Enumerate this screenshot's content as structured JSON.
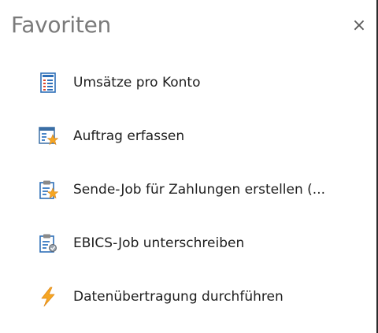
{
  "panel": {
    "title": "Favoriten",
    "close_glyph": "×"
  },
  "items": [
    {
      "label": "Umsätze pro Konto",
      "icon": "statement-list-icon"
    },
    {
      "label": "Auftrag erfassen",
      "icon": "new-order-icon"
    },
    {
      "label": "Sende-Job für Zahlungen erstellen (...",
      "icon": "clipboard-star-icon"
    },
    {
      "label": "EBICS-Job unterschreiben",
      "icon": "clipboard-sign-icon"
    },
    {
      "label": "Datenübertragung durchführen",
      "icon": "lightning-icon"
    }
  ],
  "colors": {
    "title": "#7a7a7a",
    "text": "#1e1e1e",
    "accent_blue": "#2e7bcf",
    "accent_orange": "#f5a623",
    "border": "#2b2b2b"
  }
}
